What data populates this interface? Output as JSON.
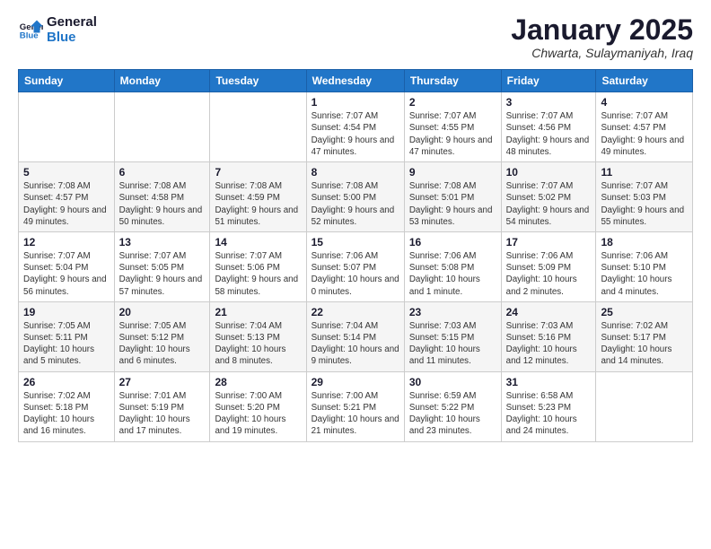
{
  "logo": {
    "line1": "General",
    "line2": "Blue"
  },
  "header": {
    "month": "January 2025",
    "location": "Chwarta, Sulaymaniyah, Iraq"
  },
  "weekdays": [
    "Sunday",
    "Monday",
    "Tuesday",
    "Wednesday",
    "Thursday",
    "Friday",
    "Saturday"
  ],
  "weeks": [
    [
      {
        "day": "",
        "info": ""
      },
      {
        "day": "",
        "info": ""
      },
      {
        "day": "",
        "info": ""
      },
      {
        "day": "1",
        "info": "Sunrise: 7:07 AM\nSunset: 4:54 PM\nDaylight: 9 hours and 47 minutes."
      },
      {
        "day": "2",
        "info": "Sunrise: 7:07 AM\nSunset: 4:55 PM\nDaylight: 9 hours and 47 minutes."
      },
      {
        "day": "3",
        "info": "Sunrise: 7:07 AM\nSunset: 4:56 PM\nDaylight: 9 hours and 48 minutes."
      },
      {
        "day": "4",
        "info": "Sunrise: 7:07 AM\nSunset: 4:57 PM\nDaylight: 9 hours and 49 minutes."
      }
    ],
    [
      {
        "day": "5",
        "info": "Sunrise: 7:08 AM\nSunset: 4:57 PM\nDaylight: 9 hours and 49 minutes."
      },
      {
        "day": "6",
        "info": "Sunrise: 7:08 AM\nSunset: 4:58 PM\nDaylight: 9 hours and 50 minutes."
      },
      {
        "day": "7",
        "info": "Sunrise: 7:08 AM\nSunset: 4:59 PM\nDaylight: 9 hours and 51 minutes."
      },
      {
        "day": "8",
        "info": "Sunrise: 7:08 AM\nSunset: 5:00 PM\nDaylight: 9 hours and 52 minutes."
      },
      {
        "day": "9",
        "info": "Sunrise: 7:08 AM\nSunset: 5:01 PM\nDaylight: 9 hours and 53 minutes."
      },
      {
        "day": "10",
        "info": "Sunrise: 7:07 AM\nSunset: 5:02 PM\nDaylight: 9 hours and 54 minutes."
      },
      {
        "day": "11",
        "info": "Sunrise: 7:07 AM\nSunset: 5:03 PM\nDaylight: 9 hours and 55 minutes."
      }
    ],
    [
      {
        "day": "12",
        "info": "Sunrise: 7:07 AM\nSunset: 5:04 PM\nDaylight: 9 hours and 56 minutes."
      },
      {
        "day": "13",
        "info": "Sunrise: 7:07 AM\nSunset: 5:05 PM\nDaylight: 9 hours and 57 minutes."
      },
      {
        "day": "14",
        "info": "Sunrise: 7:07 AM\nSunset: 5:06 PM\nDaylight: 9 hours and 58 minutes."
      },
      {
        "day": "15",
        "info": "Sunrise: 7:06 AM\nSunset: 5:07 PM\nDaylight: 10 hours and 0 minutes."
      },
      {
        "day": "16",
        "info": "Sunrise: 7:06 AM\nSunset: 5:08 PM\nDaylight: 10 hours and 1 minute."
      },
      {
        "day": "17",
        "info": "Sunrise: 7:06 AM\nSunset: 5:09 PM\nDaylight: 10 hours and 2 minutes."
      },
      {
        "day": "18",
        "info": "Sunrise: 7:06 AM\nSunset: 5:10 PM\nDaylight: 10 hours and 4 minutes."
      }
    ],
    [
      {
        "day": "19",
        "info": "Sunrise: 7:05 AM\nSunset: 5:11 PM\nDaylight: 10 hours and 5 minutes."
      },
      {
        "day": "20",
        "info": "Sunrise: 7:05 AM\nSunset: 5:12 PM\nDaylight: 10 hours and 6 minutes."
      },
      {
        "day": "21",
        "info": "Sunrise: 7:04 AM\nSunset: 5:13 PM\nDaylight: 10 hours and 8 minutes."
      },
      {
        "day": "22",
        "info": "Sunrise: 7:04 AM\nSunset: 5:14 PM\nDaylight: 10 hours and 9 minutes."
      },
      {
        "day": "23",
        "info": "Sunrise: 7:03 AM\nSunset: 5:15 PM\nDaylight: 10 hours and 11 minutes."
      },
      {
        "day": "24",
        "info": "Sunrise: 7:03 AM\nSunset: 5:16 PM\nDaylight: 10 hours and 12 minutes."
      },
      {
        "day": "25",
        "info": "Sunrise: 7:02 AM\nSunset: 5:17 PM\nDaylight: 10 hours and 14 minutes."
      }
    ],
    [
      {
        "day": "26",
        "info": "Sunrise: 7:02 AM\nSunset: 5:18 PM\nDaylight: 10 hours and 16 minutes."
      },
      {
        "day": "27",
        "info": "Sunrise: 7:01 AM\nSunset: 5:19 PM\nDaylight: 10 hours and 17 minutes."
      },
      {
        "day": "28",
        "info": "Sunrise: 7:00 AM\nSunset: 5:20 PM\nDaylight: 10 hours and 19 minutes."
      },
      {
        "day": "29",
        "info": "Sunrise: 7:00 AM\nSunset: 5:21 PM\nDaylight: 10 hours and 21 minutes."
      },
      {
        "day": "30",
        "info": "Sunrise: 6:59 AM\nSunset: 5:22 PM\nDaylight: 10 hours and 23 minutes."
      },
      {
        "day": "31",
        "info": "Sunrise: 6:58 AM\nSunset: 5:23 PM\nDaylight: 10 hours and 24 minutes."
      },
      {
        "day": "",
        "info": ""
      }
    ]
  ]
}
